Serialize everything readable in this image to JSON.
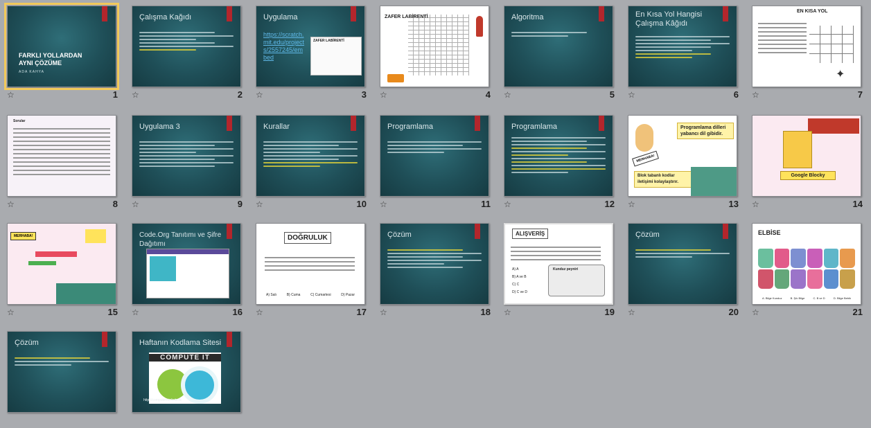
{
  "slides": [
    {
      "num": "1",
      "title": "FARKLI YOLLARDAN AYNI ÇÖZÜME",
      "subtitle": "ADA KAHYA"
    },
    {
      "num": "2",
      "title": "Çalışma Kağıdı"
    },
    {
      "num": "3",
      "title": "Uygulama",
      "link": "https://scratch.mit.edu/projects/2557245/embed",
      "image_label": "ZAFER LABİRENTİ"
    },
    {
      "num": "4",
      "title": "ZAFER LABİRENTİ"
    },
    {
      "num": "5",
      "title": "Algoritma"
    },
    {
      "num": "6",
      "title": "En Kısa Yol Hangisi Çalışma Kâğıdı"
    },
    {
      "num": "7",
      "title": "EN KISA YOL"
    },
    {
      "num": "8",
      "title": "Sorular"
    },
    {
      "num": "9",
      "title": "Uygulama 3"
    },
    {
      "num": "10",
      "title": "Kurallar"
    },
    {
      "num": "11",
      "title": "Programlama"
    },
    {
      "num": "12",
      "title": "Programlama"
    },
    {
      "num": "13",
      "title": "Programlama dilleri yabancı dil gibidir.",
      "banner2": "Blok tabanlı kodlar iletişimi kolaylaştırır.",
      "tag": "MERHABA!"
    },
    {
      "num": "14",
      "title": "Google Blocky"
    },
    {
      "num": "15",
      "title": "MERHABA!"
    },
    {
      "num": "16",
      "title": "Code.Org Tanıtımı ve Şifre Dağıtımı"
    },
    {
      "num": "17",
      "title": "DOĞRULUK",
      "answers": [
        "A) Salı",
        "B) Cuma",
        "C) Cumartesi",
        "D) Pazar"
      ]
    },
    {
      "num": "18",
      "title": "Çözüm"
    },
    {
      "num": "19",
      "title": "ALIŞVERİŞ",
      "answers": [
        "A) A",
        "B) A ve B",
        "C) C",
        "D) C ve D"
      ],
      "tag": "Kunduz peyniri"
    },
    {
      "num": "20",
      "title": "Çözüm"
    },
    {
      "num": "21",
      "title": "ELBİSE",
      "answers": [
        "A. Bilge Kunduz",
        "B. Şık Bilge",
        "C. B ve D",
        "D. Bilge Bebik"
      ]
    },
    {
      "num": "22",
      "title": "Çözüm"
    },
    {
      "num": "23",
      "title": "Haftanın Kodlama Sitesi",
      "logo": "COMPUTE IT",
      "caption": "http://computerhizlisite.tk"
    }
  ],
  "colors": {
    "dark_bg": "#1f4f58",
    "accent_red": "#b3262c",
    "selection": "#f2c95a"
  }
}
